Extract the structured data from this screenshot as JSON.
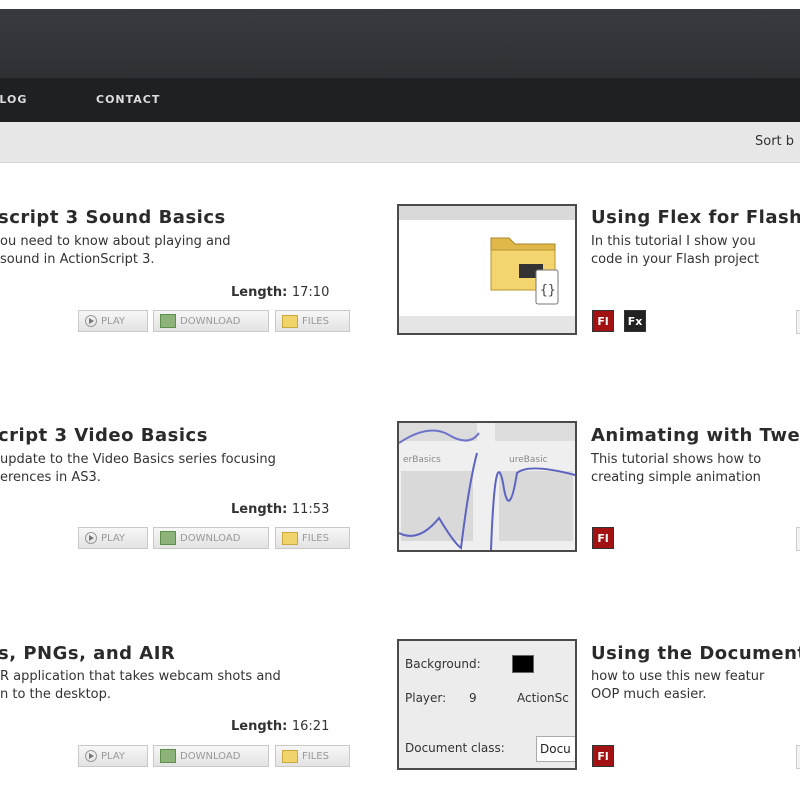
{
  "nav": {
    "blog": "BLOG",
    "contact": "CONTACT"
  },
  "sortbar": {
    "label": "Sort b"
  },
  "buttons": {
    "play": "PLAY",
    "download": "DOWNLOAD",
    "files": "FILES"
  },
  "left_items": [
    {
      "title": "script 3 Sound Basics",
      "desc1": "ou need to know about playing and",
      "desc2": "sound in ActionScript 3.",
      "length_label": "Length:",
      "length": "17:10"
    },
    {
      "title": "cript 3 Video Basics",
      "desc1": "update to the Video Basics series focusing",
      "desc2": "erences in AS3.",
      "length_label": "Length:",
      "length": "11:53"
    },
    {
      "title": "s, PNGs, and AIR",
      "desc1": "R application that takes webcam shots and",
      "desc2": "n to the desktop.",
      "length_label": "Length:",
      "length": "16:21"
    }
  ],
  "right_items": [
    {
      "title": "Using Flex for Flash",
      "desc1": "In this tutorial I show you",
      "desc2": "code in your Flash project",
      "badges": [
        "Fl",
        "Fx"
      ]
    },
    {
      "title": "Animating with Twe",
      "desc1": "This tutorial shows how to",
      "desc2": "creating simple animation",
      "badges": [
        "Fl"
      ]
    },
    {
      "title": "Using the Document",
      "desc1": "how to use this new featur",
      "desc2": "OOP much easier.",
      "badges": [
        "Fl"
      ]
    }
  ],
  "thumb3": {
    "background_label": "Background:",
    "player_label": "Player:",
    "player_value": "9",
    "actionscript_label": "ActionSc",
    "document_class_label": "Document class:",
    "document_class_value": "Docu"
  },
  "thumb2": {
    "label_left": "erBasics",
    "label_right": "ureBasic"
  },
  "colors": {
    "nav_bg": "#1f2023",
    "header_bg": "#35373b",
    "flash_badge": "#a31212",
    "flex_badge": "#222222"
  }
}
